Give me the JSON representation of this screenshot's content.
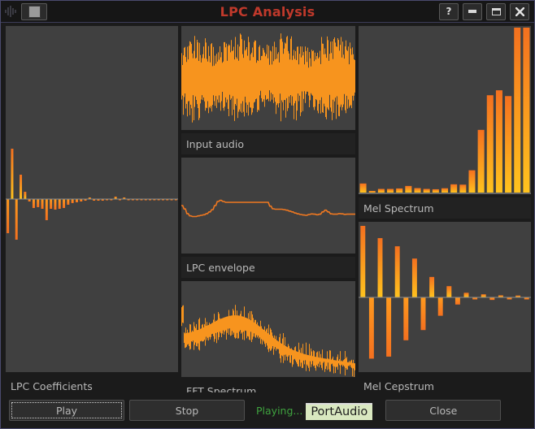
{
  "window": {
    "title": "LPC Analysis",
    "app_icon": "waveform-icon",
    "system_menu_icon": "window-menu-icon",
    "controls": {
      "help": "?",
      "minimize": "–",
      "maximize": "□",
      "close": "✖"
    },
    "accent_title_color": "#c0392b",
    "border_color": "#4a4a6e"
  },
  "panels": {
    "lpc_coefficients": {
      "caption": "LPC Coefficients"
    },
    "input_audio": {
      "caption": "Input audio"
    },
    "lpc_envelope": {
      "caption": "LPC envelope"
    },
    "fft_spectrum": {
      "caption": "FFT Spectrum"
    },
    "mel_spectrum": {
      "caption": "Mel Spectrum"
    },
    "mel_cepstrum": {
      "caption": "Mel Cepstrum"
    }
  },
  "controls": {
    "play_label": "Play",
    "stop_label": "Stop",
    "close_label": "Close",
    "status_label": "Playing...",
    "backend_label": "PortAudio",
    "status_color": "#3fa33f",
    "backend_bg": "#d9e8c0"
  },
  "chart_data": [
    {
      "id": "lpc_coefficients",
      "type": "bar",
      "title": "LPC Coefficients",
      "xlabel": "",
      "ylabel": "",
      "ylim": [
        -1,
        1
      ],
      "grid": false,
      "bipolar": true,
      "bar_gradient": [
        "#f4701f",
        "#ffc31e"
      ],
      "values": [
        -0.42,
        0.62,
        -0.5,
        0.3,
        0.09,
        -0.03,
        -0.11,
        -0.1,
        -0.12,
        -0.26,
        -0.12,
        -0.13,
        -0.12,
        -0.11,
        -0.07,
        -0.05,
        -0.04,
        -0.03,
        -0.02,
        0.02,
        -0.02,
        -0.02,
        -0.02,
        -0.01,
        -0.01,
        0.03,
        -0.01,
        0.02,
        -0.01,
        -0.01,
        -0.01,
        -0.01,
        -0.01,
        -0.01,
        -0.01,
        -0.01,
        -0.01,
        -0.01,
        -0.01,
        -0.01
      ]
    },
    {
      "id": "input_audio",
      "type": "line",
      "title": "Input audio",
      "xlabel": "",
      "ylabel": "",
      "ylim": [
        -1,
        1
      ],
      "grid": false,
      "color": "#f7941e",
      "description": "dense time-domain waveform, full-scale noise-like speech signal"
    },
    {
      "id": "lpc_envelope",
      "type": "line",
      "title": "LPC envelope",
      "xlabel": "",
      "ylabel": "",
      "ylim": [
        0,
        1
      ],
      "grid": false,
      "color": "#f07820",
      "points": [
        0.6,
        0.57,
        0.53,
        0.51,
        0.505,
        0.505,
        0.51,
        0.515,
        0.52,
        0.53,
        0.545,
        0.565,
        0.6,
        0.635,
        0.645,
        0.635,
        0.628,
        0.628,
        0.628,
        0.628,
        0.628,
        0.628,
        0.628,
        0.628,
        0.628,
        0.628,
        0.628,
        0.628,
        0.628,
        0.628,
        0.628,
        0.628,
        0.595,
        0.572,
        0.568,
        0.568,
        0.568,
        0.565,
        0.56,
        0.552,
        0.545,
        0.535,
        0.528,
        0.522,
        0.518,
        0.515,
        0.522,
        0.527,
        0.525,
        0.52,
        0.525,
        0.545,
        0.56,
        0.545,
        0.528,
        0.525,
        0.525,
        0.53,
        0.528,
        0.524,
        0.525,
        0.525,
        0.525,
        0.525
      ]
    },
    {
      "id": "fft_spectrum",
      "type": "line",
      "title": "FFT Spectrum",
      "xlabel": "",
      "ylabel": "",
      "ylim": [
        0,
        1
      ],
      "grid": false,
      "color": "#f7941e",
      "description": "noisy magnitude spectrum, rising to a broad peak near one third of the band then decaying toward high frequency"
    },
    {
      "id": "mel_spectrum",
      "type": "bar",
      "title": "Mel Spectrum",
      "xlabel": "",
      "ylabel": "",
      "ylim": [
        0,
        1
      ],
      "grid": false,
      "bar_gradient": [
        "#f4701f",
        "#ffc31e"
      ],
      "values": [
        0.055,
        0.01,
        0.022,
        0.022,
        0.025,
        0.04,
        0.027,
        0.022,
        0.02,
        0.026,
        0.05,
        0.048,
        0.135,
        0.38,
        0.59,
        0.62,
        0.585,
        1.0,
        1.0
      ]
    },
    {
      "id": "mel_cepstrum",
      "type": "bar",
      "title": "Mel Cepstrum",
      "xlabel": "",
      "ylabel": "",
      "ylim": [
        -1,
        1
      ],
      "grid": false,
      "bipolar": true,
      "bar_gradient": [
        "#f4701f",
        "#ffc31e"
      ],
      "values": [
        0.7,
        -0.6,
        0.58,
        -0.58,
        0.5,
        -0.42,
        0.38,
        -0.32,
        0.2,
        -0.18,
        0.11,
        -0.07,
        0.045,
        -0.02,
        0.03,
        -0.025,
        0.02,
        -0.02,
        0.018,
        -0.02
      ]
    }
  ]
}
